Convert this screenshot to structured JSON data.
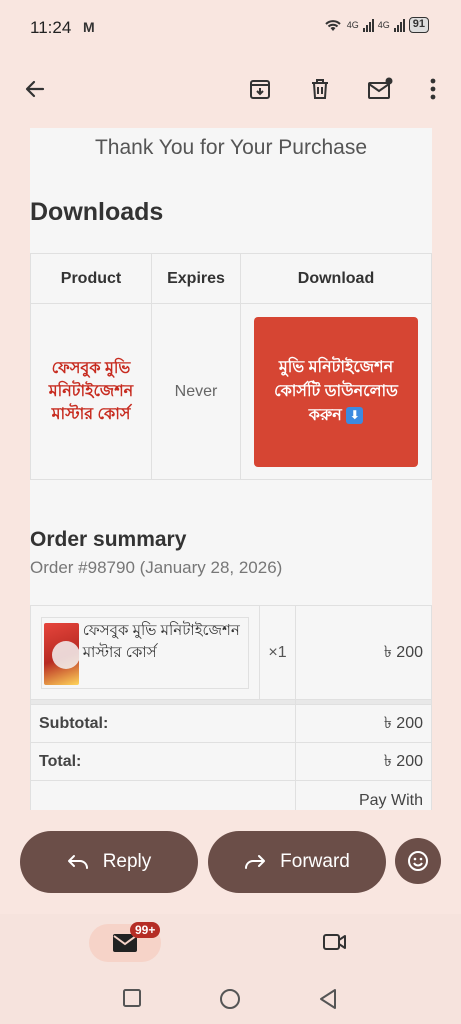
{
  "status_bar": {
    "time": "11:24",
    "mail_indicator": "M",
    "network_1": "4G",
    "network_2": "4G",
    "battery": "91"
  },
  "toolbar": {
    "icons": [
      "back-arrow-icon",
      "archive-icon",
      "delete-icon",
      "mark-unread-icon",
      "more-vert-icon"
    ]
  },
  "email": {
    "thanks": "Thank You for Your Purchase",
    "downloads_title": "Downloads",
    "downloads_table": {
      "headers": [
        "Product",
        "Expires",
        "Download"
      ],
      "product": "ফেসবুক মুভি মনিটাইজেশন মাস্টার কোর্স",
      "expires": "Never",
      "download_label": "মুভি মনিটাইজেশন কোর্সটি ডাউনলোড করুন",
      "download_arrow": "⬇"
    },
    "order_summary_title": "Order summary",
    "order_number": "Order #98790 (January 28, 2026)",
    "order_table": {
      "item_name": "ফেসবুক মুভি মনিটাইজেশন মাস্টার কোর্স",
      "qty": "×1",
      "price": "৳ 200",
      "subtotal_label": "Subtotal:",
      "subtotal_value": "৳ 200",
      "total_label": "Total:",
      "total_value": "৳ 200",
      "pay_with": "Pay With"
    }
  },
  "actions": {
    "reply": "Reply",
    "forward": "Forward"
  },
  "bottom_nav": {
    "mail_badge": "99+"
  },
  "colors": {
    "accent_brown": "#6b4e48",
    "download_red": "#d64533",
    "product_link": "#c72b1f",
    "background": "#f9e6e0"
  }
}
